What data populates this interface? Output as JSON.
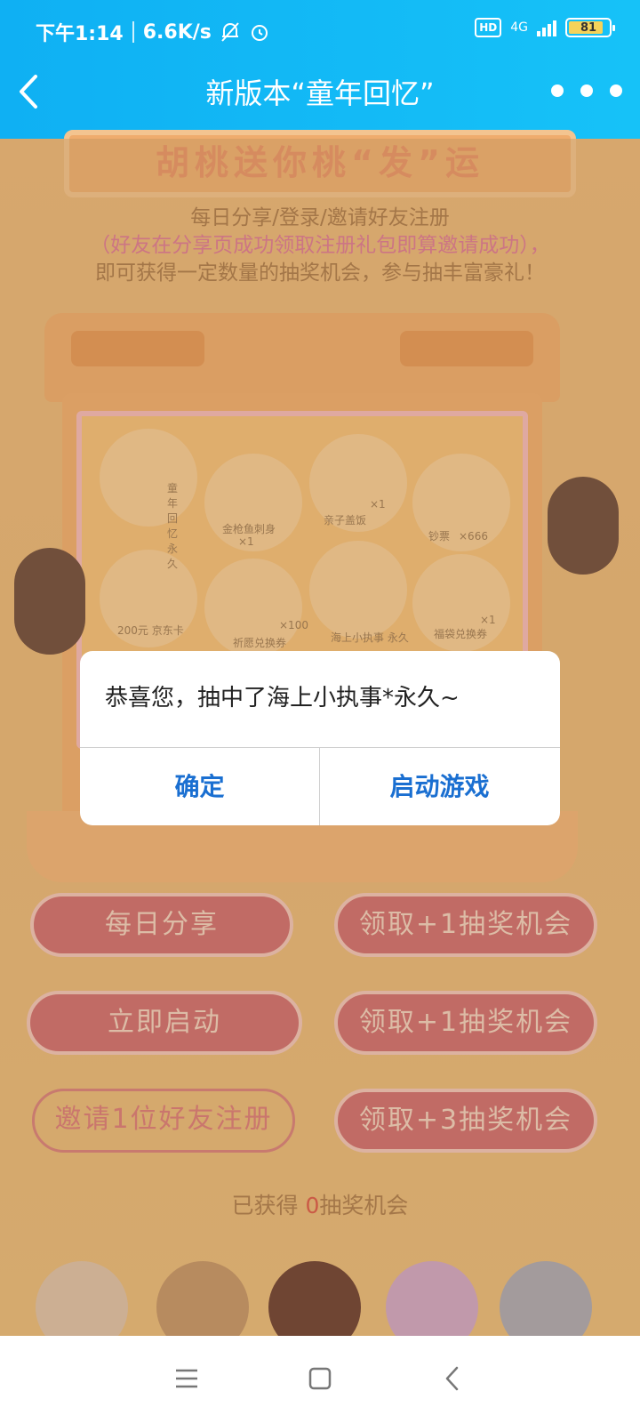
{
  "status_bar": {
    "time": "下午1:14",
    "speed": "6.6K/s",
    "hd": "HD",
    "network": "4G",
    "battery": "81"
  },
  "header": {
    "title": "新版本“童年回忆”"
  },
  "page": {
    "banner": "胡桃送你桃“发”运",
    "desc_line1": "每日分享/登录/邀请好友注册",
    "desc_line2": "（好友在分享页成功领取注册礼包即算邀请成功），",
    "desc_line3": "即可获得一定数量的抽奖机会，参与抽丰富豪礼！",
    "prizes": [
      {
        "name": "童年回忆 永久"
      },
      {
        "name": "金枪鱼刺身",
        "qty": "×1"
      },
      {
        "name": "亲子盖饭",
        "qty": "×1"
      },
      {
        "name": "钞票",
        "qty": "×666"
      },
      {
        "name": "200元 京东卡"
      },
      {
        "name": "祈愿兑换券",
        "qty": "×100"
      },
      {
        "name": "海上小执事 永久"
      },
      {
        "name": "福袋兑换券",
        "qty": "×1"
      }
    ],
    "buttons": {
      "daily_share": "每日分享",
      "claim1a": "领取+1抽奖机会",
      "launch_now": "立即启动",
      "claim1b": "领取+1抽奖机会",
      "invite": "邀请1位好友注册",
      "claim3": "领取+3抽奖机会"
    },
    "got_prefix": "已获得",
    "got_count": "0",
    "got_suffix": "抽奖机会"
  },
  "dialog": {
    "message": "恭喜您，抽中了海上小执事*永久~",
    "confirm": "确定",
    "launch_game": "启动游戏"
  },
  "colors": {
    "header": "#16c2f8",
    "dialog_button": "#1a6fd1",
    "pill_button": "#c8596c"
  }
}
